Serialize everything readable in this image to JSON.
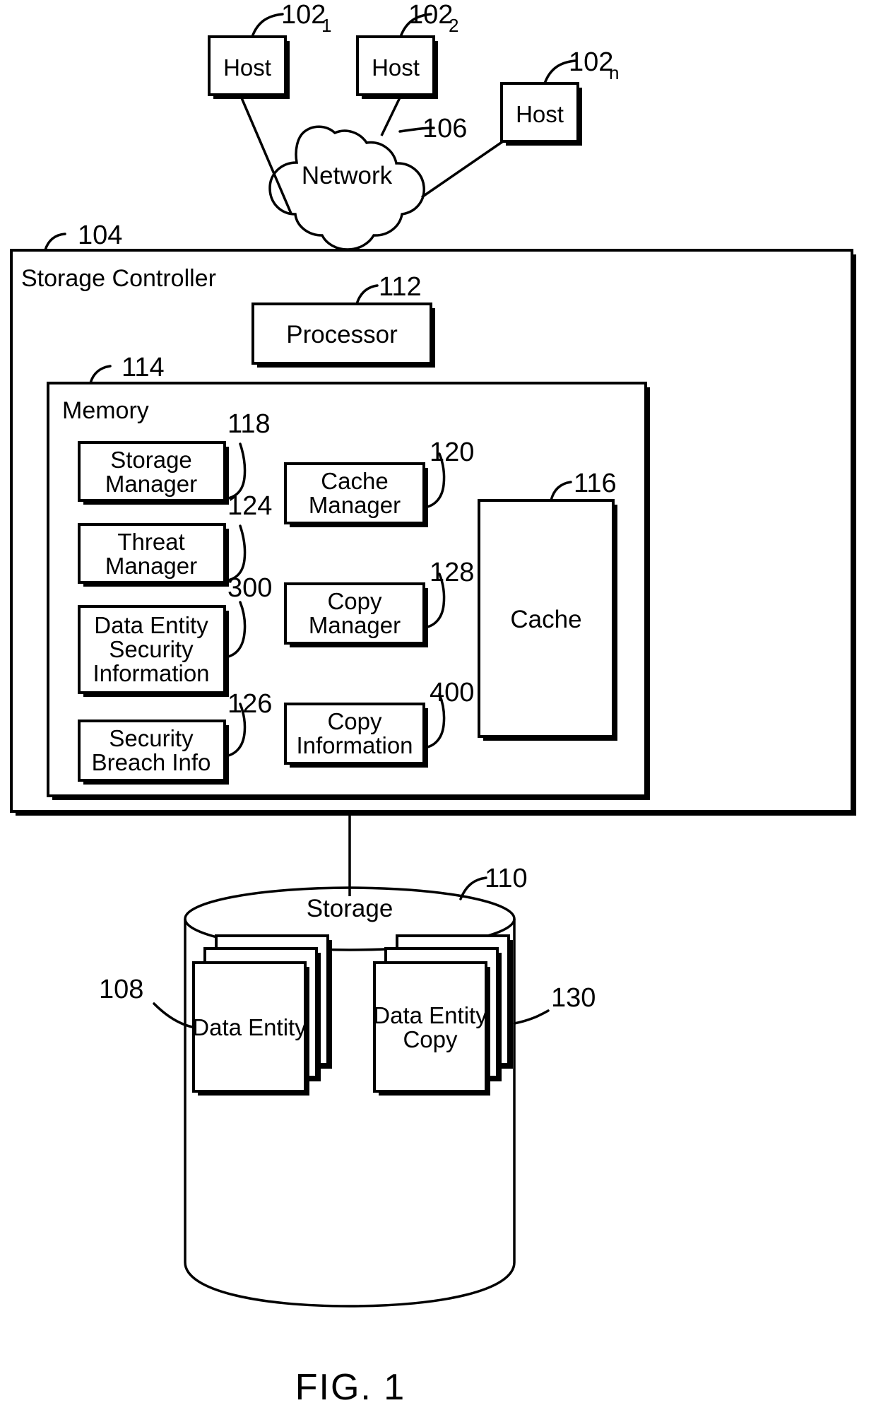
{
  "figure": {
    "caption": "FIG. 1"
  },
  "hosts": [
    {
      "label": "Host",
      "ref": "102",
      "sub": "1"
    },
    {
      "label": "Host",
      "ref": "102",
      "sub": "2"
    },
    {
      "label": "Host",
      "ref": "102",
      "sub": "n"
    }
  ],
  "network": {
    "label": "Network",
    "ref": "106"
  },
  "storage_controller": {
    "label": "Storage Controller",
    "ref": "104",
    "processor": {
      "label": "Processor",
      "ref": "112"
    },
    "memory": {
      "label": "Memory",
      "ref": "114",
      "left_column": [
        {
          "line1": "Storage",
          "line2": "Manager",
          "line3": "",
          "ref": "118"
        },
        {
          "line1": "Threat",
          "line2": "Manager",
          "line3": "",
          "ref": "124"
        },
        {
          "line1": "Data Entity",
          "line2": "Security",
          "line3": "Information",
          "ref": "300"
        },
        {
          "line1": "Security",
          "line2": "Breach Info",
          "line3": "",
          "ref": "126"
        }
      ],
      "middle_column": [
        {
          "line1": "Cache",
          "line2": "Manager",
          "ref": "120"
        },
        {
          "line1": "Copy",
          "line2": "Manager",
          "ref": "128"
        },
        {
          "line1": "Copy",
          "line2": "Information",
          "ref": "400"
        }
      ],
      "cache": {
        "label": "Cache",
        "ref": "116"
      }
    }
  },
  "storage": {
    "label": "Storage",
    "ref": "110",
    "data_entity": {
      "line1": "Data Entity",
      "line2": "",
      "ref": "108"
    },
    "data_entity_copy": {
      "line1": "Data Entity",
      "line2": "Copy",
      "ref": "130"
    }
  },
  "colors": {
    "ink": "#000000",
    "paper": "#ffffff"
  }
}
